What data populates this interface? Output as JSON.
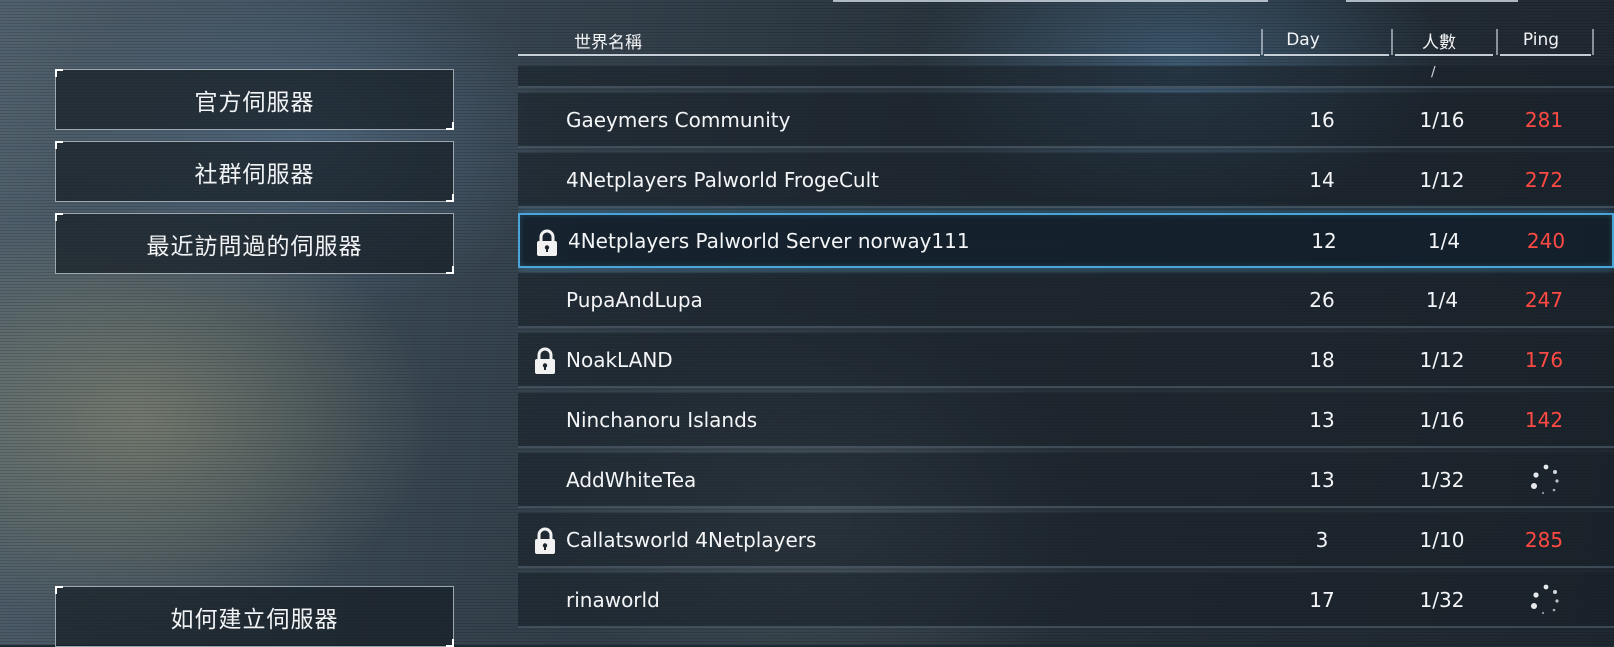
{
  "left_menu": {
    "official": "官方伺服器",
    "community": "社群伺服器",
    "recent": "最近訪問過的伺服器",
    "how_to_create": "如何建立伺服器"
  },
  "table": {
    "headers": {
      "name": "世界名稱",
      "day": "Day",
      "players": "人數",
      "ping": "Ping"
    },
    "partial_row_players": "/",
    "rows": [
      {
        "name": "Gaeymers Community",
        "day": "16",
        "players": "1/16",
        "ping": "281",
        "locked": false,
        "loading": false,
        "selected": false
      },
      {
        "name": "4Netplayers Palworld FrogeCult",
        "day": "14",
        "players": "1/12",
        "ping": "272",
        "locked": false,
        "loading": false,
        "selected": false
      },
      {
        "name": "4Netplayers Palworld Server norway111",
        "day": "12",
        "players": "1/4",
        "ping": "240",
        "locked": true,
        "loading": false,
        "selected": true
      },
      {
        "name": "PupaAndLupa",
        "day": "26",
        "players": "1/4",
        "ping": "247",
        "locked": false,
        "loading": false,
        "selected": false
      },
      {
        "name": "NoakLAND",
        "day": "18",
        "players": "1/12",
        "ping": "176",
        "locked": true,
        "loading": false,
        "selected": false
      },
      {
        "name": "Ninchanoru Islands",
        "day": "13",
        "players": "1/16",
        "ping": "142",
        "locked": false,
        "loading": false,
        "selected": false
      },
      {
        "name": "AddWhiteTea",
        "day": "13",
        "players": "1/32",
        "ping": "",
        "locked": false,
        "loading": true,
        "selected": false
      },
      {
        "name": "Callatsworld 4Netplayers",
        "day": "3",
        "players": "1/10",
        "ping": "285",
        "locked": true,
        "loading": false,
        "selected": false
      },
      {
        "name": "rinaworld",
        "day": "17",
        "players": "1/32",
        "ping": "",
        "locked": false,
        "loading": true,
        "selected": false
      }
    ]
  },
  "colors": {
    "ping_text": "#ff4a44",
    "selection_border": "#4aa6d8"
  },
  "icons": {
    "lock": "lock-icon",
    "loading": "loading-spinner-icon"
  }
}
